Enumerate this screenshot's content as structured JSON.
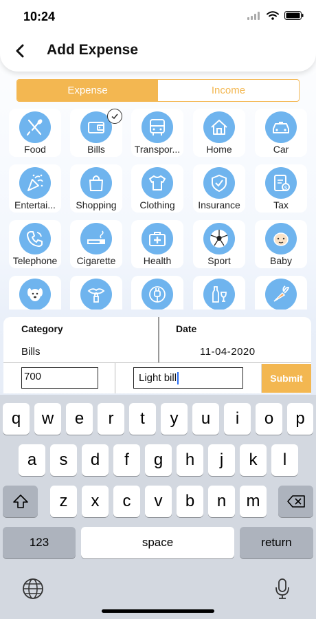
{
  "status": {
    "time": "10:24"
  },
  "header": {
    "title": "Add Expense"
  },
  "tabs": [
    {
      "label": "Expense"
    },
    {
      "label": "Income"
    }
  ],
  "categories": [
    {
      "label": "Food",
      "icon": "fork-knife-icon"
    },
    {
      "label": "Bills",
      "icon": "wallet-icon",
      "selected": true
    },
    {
      "label": "Transpor...",
      "icon": "bus-icon"
    },
    {
      "label": "Home",
      "icon": "house-icon"
    },
    {
      "label": "Car",
      "icon": "car-icon"
    },
    {
      "label": "Entertai...",
      "icon": "party-popper-icon"
    },
    {
      "label": "Shopping",
      "icon": "shopping-bag-icon"
    },
    {
      "label": "Clothing",
      "icon": "tshirt-icon"
    },
    {
      "label": "Insurance",
      "icon": "shield-icon"
    },
    {
      "label": "Tax",
      "icon": "tax-document-icon"
    },
    {
      "label": "Telephone",
      "icon": "phone-icon"
    },
    {
      "label": "Cigarette",
      "icon": "cigarette-icon"
    },
    {
      "label": "Health",
      "icon": "first-aid-kit-icon"
    },
    {
      "label": "Sport",
      "icon": "soccer-ball-icon"
    },
    {
      "label": "Baby",
      "icon": "baby-icon"
    },
    {
      "label": "",
      "icon": "dog-icon"
    },
    {
      "label": "",
      "icon": "lipstick-icon"
    },
    {
      "label": "",
      "icon": "plug-icon"
    },
    {
      "label": "",
      "icon": "wine-icon"
    },
    {
      "label": "",
      "icon": "carrot-icon"
    }
  ],
  "form": {
    "category_label": "Category",
    "category_value": "Bills",
    "date_label": "Date",
    "date_value": "11-04-2020",
    "amount_value": "700",
    "note_value": "Light bill",
    "submit_label": "Submit"
  },
  "keyboard": {
    "row1": [
      "q",
      "w",
      "e",
      "r",
      "t",
      "y",
      "u",
      "i",
      "o",
      "p"
    ],
    "row2": [
      "a",
      "s",
      "d",
      "f",
      "g",
      "h",
      "j",
      "k",
      "l"
    ],
    "row3": [
      "z",
      "x",
      "c",
      "v",
      "b",
      "n",
      "m"
    ],
    "numbers_label": "123",
    "space_label": "space",
    "return_label": "return"
  },
  "colors": {
    "accent": "#f3b751",
    "icon_bg": "#6fb4ee"
  }
}
